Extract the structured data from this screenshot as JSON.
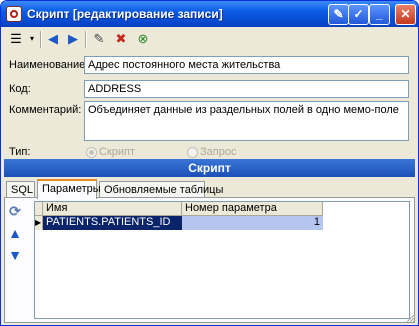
{
  "window": {
    "title": "Скрипт [редактирование записи]",
    "controls": [
      "settings-icon",
      "help-icon",
      "minimize-icon",
      "maximize-icon",
      "close-icon"
    ]
  },
  "toolbar": {
    "icons": [
      "list-view-icon",
      "dropdown-icon",
      "back-arrow-icon",
      "forward-arrow-icon",
      "edit-icon",
      "delete-icon",
      "close-document-icon"
    ]
  },
  "form": {
    "name_label": "Наименование:",
    "name_value": "Адрес постоянного места жительства",
    "code_label": "Код:",
    "code_value": "ADDRESS",
    "comment_label": "Комментарий:",
    "comment_value": "Объединяет данные из раздельных полей в одно мемо-поле",
    "type_label": "Тип:",
    "type_options": [
      "Скрипт",
      "Запрос"
    ],
    "type_selected": "Скрипт"
  },
  "section": {
    "title": "Скрипт"
  },
  "tabs": [
    {
      "label": "SQL",
      "active": false
    },
    {
      "label": "Параметры",
      "active": true
    },
    {
      "label": "Обновляемые таблицы",
      "active": false
    }
  ],
  "side_buttons": [
    "refresh-icon",
    "up-arrow-icon",
    "down-arrow-icon"
  ],
  "grid": {
    "columns": [
      "Имя",
      "Номер параметра"
    ],
    "rows": [
      {
        "name": "PATIENTS.PATIENTS_ID",
        "number": "1"
      }
    ]
  },
  "colors": {
    "titlebar": "#0a5ce5",
    "selection": "#0a246a",
    "selection_cell": "#b6c5ef"
  }
}
